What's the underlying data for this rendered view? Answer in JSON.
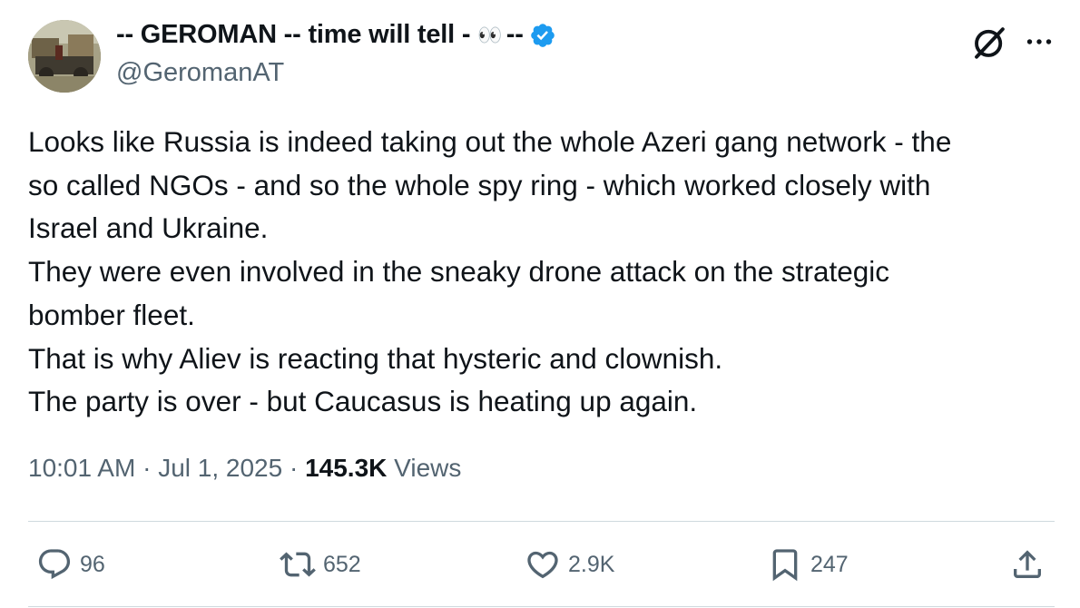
{
  "author": {
    "display_name": "-- GEROMAN -- time will tell -",
    "display_name_emoji": "👀",
    "display_name_suffix": "--",
    "handle": "@GeromanAT",
    "verified_color": "#1d9bf0"
  },
  "tweet": {
    "lines": [
      "Looks like Russia is indeed taking out the whole Azeri gang network - the",
      "so called NGOs - and so the whole spy ring - which worked closely with",
      "Israel and Ukraine.",
      "They were even involved in the sneaky drone attack on the strategic",
      "bomber fleet.",
      "That is why Aliev is reacting that hysteric and clownish.",
      "The party is over - but Caucasus is heating up again."
    ],
    "time": "10:01 AM",
    "date": "Jul 1, 2025",
    "views_count": "145.3K",
    "views_label": "Views"
  },
  "actions": {
    "replies": "96",
    "reposts": "652",
    "likes": "2.9K",
    "bookmarks": "247"
  },
  "icons": {
    "header": [
      "grok-icon",
      "more-icon"
    ],
    "actions": [
      "reply-icon",
      "repost-icon",
      "like-icon",
      "bookmark-icon",
      "share-icon"
    ]
  },
  "colors": {
    "text": "#0f1419",
    "secondary": "#536471",
    "divider": "#cfd9de"
  }
}
